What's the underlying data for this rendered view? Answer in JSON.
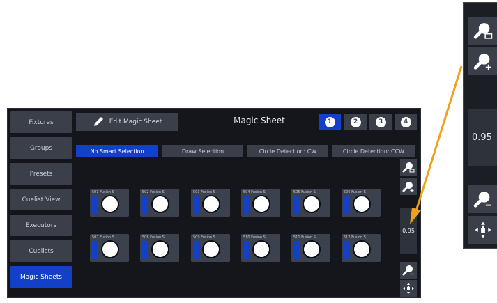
{
  "sidebar": {
    "items": [
      {
        "label": "Fixtures",
        "active": false
      },
      {
        "label": "Groups",
        "active": false
      },
      {
        "label": "Presets",
        "active": false
      },
      {
        "label": "Cuelist View",
        "active": false
      },
      {
        "label": "Executors",
        "active": false
      },
      {
        "label": "Cuelists",
        "active": false
      },
      {
        "label": "Magic Sheets",
        "active": true
      }
    ]
  },
  "header": {
    "edit_label": "Edit Magic Sheet",
    "title": "Magic Sheet",
    "pages": [
      "1",
      "2",
      "3",
      "4"
    ],
    "active_page": "1"
  },
  "modes": [
    {
      "label": "No Smart Selection",
      "active": true
    },
    {
      "label": "Draw Selection",
      "active": false
    },
    {
      "label": "Circle Detection: CW",
      "active": false
    },
    {
      "label": "Circle Detection: CCW",
      "active": false
    }
  ],
  "fixtures": [
    {
      "id": "501",
      "type": "Fusion S"
    },
    {
      "id": "502",
      "type": "Fusion S"
    },
    {
      "id": "503",
      "type": "Fusion S"
    },
    {
      "id": "504",
      "type": "Fusion S"
    },
    {
      "id": "505",
      "type": "Fusion S"
    },
    {
      "id": "506",
      "type": "Fusion S"
    },
    {
      "id": "507",
      "type": "Fusion S"
    },
    {
      "id": "508",
      "type": "Fusion S"
    },
    {
      "id": "509",
      "type": "Fusion S"
    },
    {
      "id": "510",
      "type": "Fusion S"
    },
    {
      "id": "511",
      "type": "Fusion S"
    },
    {
      "id": "512",
      "type": "Fusion S"
    }
  ],
  "zoom": {
    "value": "0.95"
  },
  "icons": {
    "zoom_fit": "zoom-fit-icon",
    "zoom_in": "zoom-in-icon",
    "zoom_out": "zoom-out-icon",
    "pan": "pan-icon"
  },
  "colors": {
    "accent": "#1340c8",
    "button": "#3a3f4a",
    "background": "#14161b",
    "callout_arrow": "#f0a01e"
  }
}
